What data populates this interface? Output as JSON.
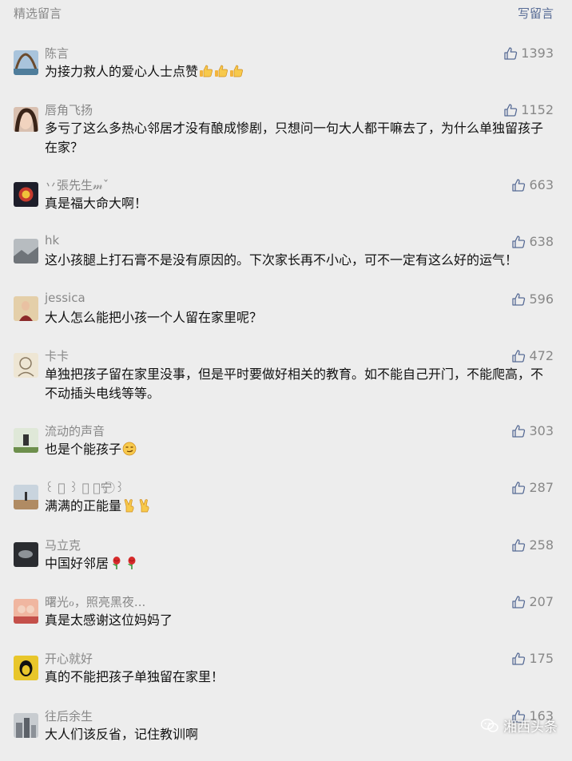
{
  "header": {
    "title": "精选留言",
    "write_label": "写留言"
  },
  "colors": {
    "link": "#576b95",
    "muted": "#888888",
    "background": "#ededed"
  },
  "comments": [
    {
      "name": "陈言",
      "text": "为接力救人的爱心人士点赞",
      "likes": "1393",
      "avatar": "avatar-landscape",
      "emoji": [
        "thumbs-up-emoji",
        "thumbs-up-emoji",
        "thumbs-up-emoji"
      ]
    },
    {
      "name": "唇角飞扬",
      "text": "多亏了这么多热心邻居才没有酿成惨剧，只想问一句大人都干嘛去了，为什么单独留孩子在家？",
      "likes": "1152",
      "avatar": "avatar-portrait"
    },
    {
      "name": "丷張先生𝓂ˇ",
      "text": "真是福大命大啊！",
      "likes": "663",
      "avatar": "avatar-dark"
    },
    {
      "name": "hk",
      "text": "这小孩腿上打石膏不是没有原因的。下次家长再不小心，可不一定有这么好的运气！",
      "likes": "638",
      "avatar": "avatar-gray"
    },
    {
      "name": "jessica",
      "text": "大人怎么能把小孩一个人留在家里呢？",
      "likes": "596",
      "avatar": "avatar-girl"
    },
    {
      "name": "卡卡",
      "text": "单独把孩子留在家里没事，但是平时要做好相关的教育。如不能自己开门，不能爬高，不不动插头电线等等。",
      "likes": "472",
      "avatar": "avatar-sketch"
    },
    {
      "name": "流动的声音",
      "text": "也是个能孩子",
      "likes": "303",
      "avatar": "avatar-outdoor",
      "emoji": [
        "smirk-emoji"
      ]
    },
    {
      "name": "꒰ ⃝ ꒱ ⃝ ⃝宁 ⃝꒱",
      "text": "满满的正能量",
      "likes": "287",
      "avatar": "avatar-field",
      "emoji": [
        "victory-emoji",
        "victory-emoji"
      ]
    },
    {
      "name": "马立克",
      "text": "中国好邻居",
      "likes": "258",
      "avatar": "avatar-dark-scene",
      "emoji": [
        "rose-emoji",
        "rose-emoji"
      ]
    },
    {
      "name": "曙光ℴ，照亮黑夜...",
      "text": "真是太感谢这位妈妈了",
      "likes": "207",
      "avatar": "avatar-couple"
    },
    {
      "name": "开心就好",
      "text": "真的不能把孩子单独留在家里！",
      "likes": "175",
      "avatar": "avatar-che"
    },
    {
      "name": "往后余生",
      "text": "大人们该反省，记住教训啊",
      "likes": "163",
      "avatar": "avatar-city"
    }
  ],
  "watermark": {
    "text": "湘西头条",
    "icon": "wechat-icon"
  }
}
